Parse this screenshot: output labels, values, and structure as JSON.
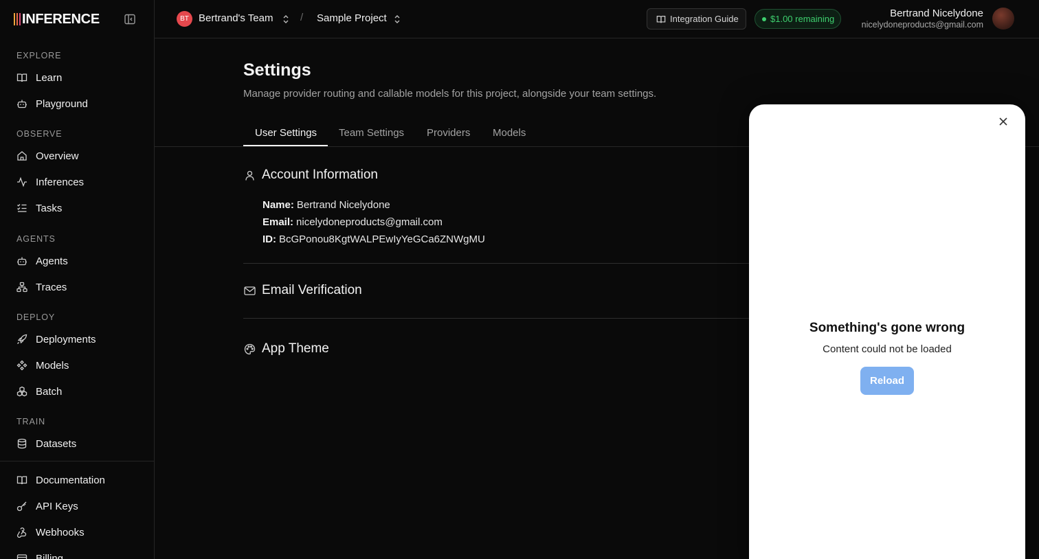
{
  "brand": {
    "logo_text": "INFERENCE"
  },
  "sidebar": {
    "sections": [
      {
        "label": "EXPLORE"
      },
      {
        "label": "OBSERVE"
      },
      {
        "label": "AGENTS"
      },
      {
        "label": "DEPLOY"
      },
      {
        "label": "TRAIN"
      }
    ],
    "items": [
      {
        "label": "Learn",
        "icon": "book-icon"
      },
      {
        "label": "Playground",
        "icon": "robot-icon"
      },
      {
        "label": "Overview",
        "icon": "home-icon"
      },
      {
        "label": "Inferences",
        "icon": "activity-icon"
      },
      {
        "label": "Tasks",
        "icon": "list-check-icon"
      },
      {
        "label": "Agents",
        "icon": "robot-icon"
      },
      {
        "label": "Traces",
        "icon": "workflow-icon"
      },
      {
        "label": "Deployments",
        "icon": "rocket-icon"
      },
      {
        "label": "Models",
        "icon": "diamonds-icon"
      },
      {
        "label": "Batch",
        "icon": "boxes-icon"
      },
      {
        "label": "Datasets",
        "icon": "database-icon"
      },
      {
        "label": "Documentation",
        "icon": "book-icon"
      },
      {
        "label": "API Keys",
        "icon": "key-icon"
      },
      {
        "label": "Webhooks",
        "icon": "webhook-icon"
      },
      {
        "label": "Billing",
        "icon": "card-icon"
      }
    ]
  },
  "header": {
    "team_initials": "BT",
    "team_name": "Bertrand's Team",
    "separator": "/",
    "project_name": "Sample Project",
    "integration_guide": "Integration Guide",
    "credit": "$1.00 remaining",
    "user_name": "Bertrand Nicelydone",
    "user_email": "nicelydoneproducts@gmail.com"
  },
  "page": {
    "title": "Settings",
    "subtitle": "Manage provider routing and callable models for this project, alongside your team settings.",
    "tabs": [
      "User Settings",
      "Team Settings",
      "Providers",
      "Models"
    ],
    "active_tab": "User Settings"
  },
  "account": {
    "title": "Account Information",
    "name_label": "Name:",
    "name_value": "Bertrand Nicelydone",
    "email_label": "Email:",
    "email_value": "nicelydoneproducts@gmail.com",
    "id_label": "ID:",
    "id_value": "BcGPonou8KgtWALPEwIyYeGCa6ZNWgMU"
  },
  "email_verification": {
    "title": "Email Verification"
  },
  "app_theme": {
    "title": "App Theme"
  },
  "panel": {
    "error_title": "Something's gone wrong",
    "error_subtitle": "Content could not be loaded",
    "reload_label": "Reload"
  },
  "colors": {
    "background": "#0a0a0a",
    "accent_green": "#3ecf6e",
    "team_avatar": "#e5484d",
    "reload_button": "#7fb0f0"
  }
}
